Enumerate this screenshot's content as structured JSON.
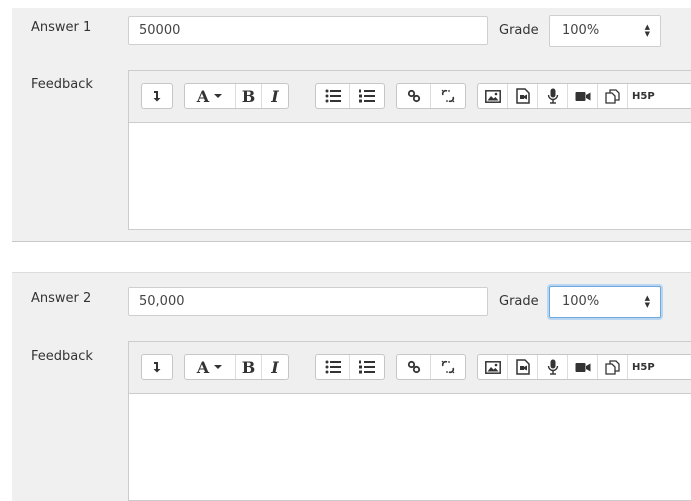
{
  "answers": [
    {
      "label": "Answer 1",
      "value": "50000",
      "grade_label": "Grade",
      "grade_value": "100%",
      "feedback_label": "Feedback",
      "grade_focused": false
    },
    {
      "label": "Answer 2",
      "value": "50,000",
      "grade_label": "Grade",
      "grade_value": "100%",
      "feedback_label": "Feedback",
      "grade_focused": true
    }
  ],
  "toolbar": {
    "buttons": [
      "collapse-icon",
      "font-icon",
      "bold-icon",
      "italic-icon",
      "unordered-list-icon",
      "ordered-list-icon",
      "link-icon",
      "unlink-icon",
      "image-icon",
      "media-icon",
      "record-audio-icon",
      "record-video-icon",
      "manage-files-icon",
      "h5p-icon"
    ],
    "font_glyph": "A",
    "bold_glyph": "B",
    "italic_glyph": "I",
    "h5p_glyph": "H5P"
  },
  "colors": {
    "panel_bg": "#f0f0f0",
    "focus_border": "#6fa8dc",
    "toolbar_bg": "#efefef"
  }
}
